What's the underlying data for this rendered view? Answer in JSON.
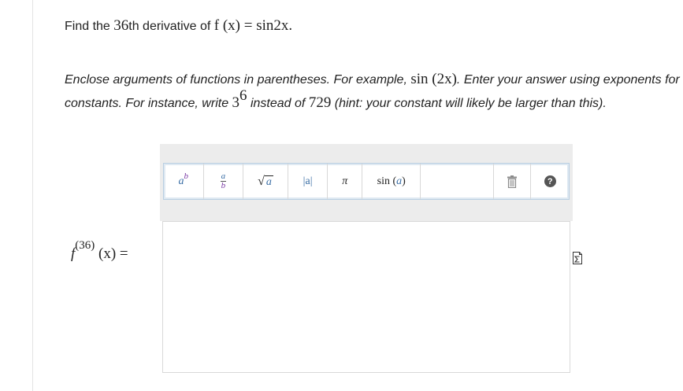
{
  "question": {
    "prefix": "Find the ",
    "ordinal_number": "36",
    "ordinal_suffix": "th derivative of ",
    "function": "f (x) = sin2x",
    "period": "."
  },
  "instructions": {
    "line1_text": "Enclose arguments of functions in parentheses. For example, ",
    "line1_example": "sin (2x)",
    "line1_tail": ". Enter your answer using exponents for numerical",
    "line2_text": "constants. For instance, write ",
    "line2_base": "3",
    "line2_exp": "6",
    "line2_mid": " instead of ",
    "line2_num": "729",
    "line2_tail": " (hint: your constant will likely be larger than this)."
  },
  "toolbar": {
    "power": {
      "base": "a",
      "exp": "b"
    },
    "fraction": {
      "num": "a",
      "den": "b"
    },
    "sqrt": {
      "symbol": "√",
      "arg": "a"
    },
    "abs": {
      "label": "|a|"
    },
    "pi": {
      "label": "π"
    },
    "sin": {
      "name": "sin",
      "arg": "a"
    },
    "help": {
      "label": "?"
    }
  },
  "answer": {
    "label_f": "f",
    "label_order": "(36)",
    "label_rest": " (x) ="
  },
  "icons": {
    "trash": "trash-icon",
    "help": "help-icon",
    "sigma": "sigma-icon"
  }
}
